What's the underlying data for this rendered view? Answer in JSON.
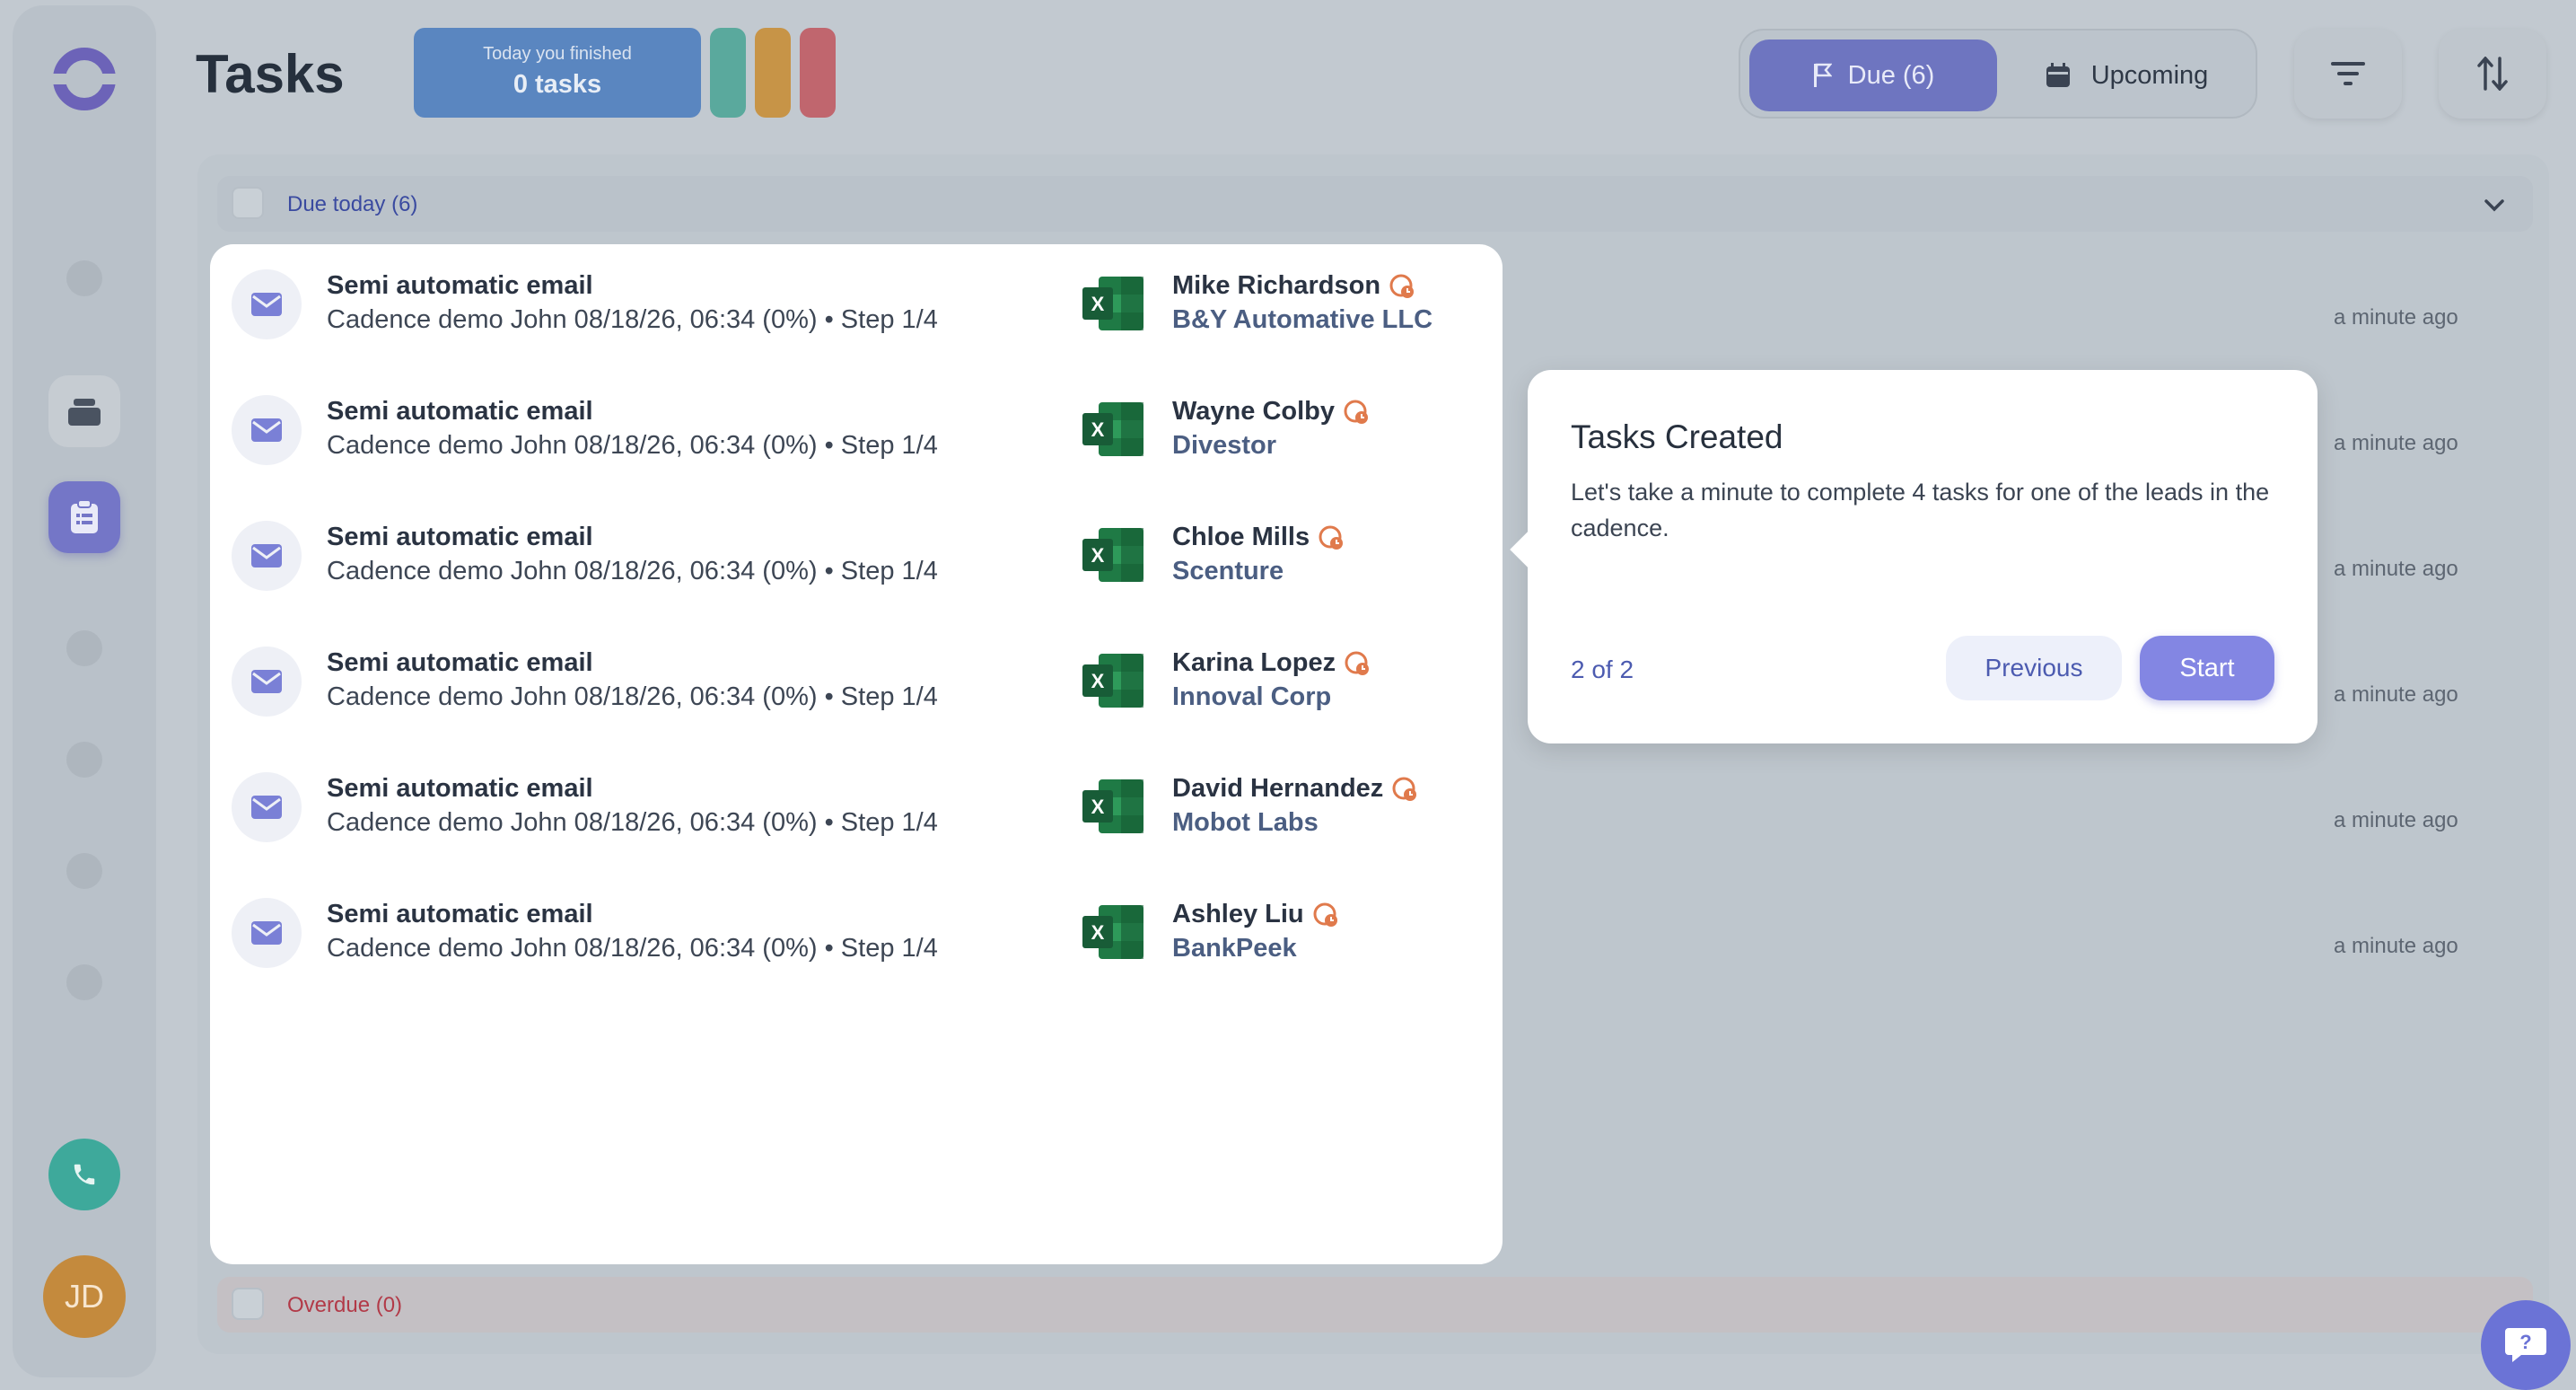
{
  "header": {
    "title": "Tasks",
    "finished_small": "Today you finished",
    "finished_count": "0 tasks",
    "tabs": {
      "due": "Due (6)",
      "upcoming": "Upcoming"
    }
  },
  "sections": {
    "due_today": "Due today (6)",
    "overdue": "Overdue (0)"
  },
  "tasks": [
    {
      "title": "Semi automatic email",
      "subtitle": "Cadence demo John 08/18/26, 06:34 (0%) • Step 1/4",
      "lead": "Mike Richardson",
      "company": "B&Y Automative LLC",
      "time": "a minute ago"
    },
    {
      "title": "Semi automatic email",
      "subtitle": "Cadence demo John 08/18/26, 06:34 (0%) • Step 1/4",
      "lead": "Wayne Colby",
      "company": "Divestor",
      "time": "a minute ago"
    },
    {
      "title": "Semi automatic email",
      "subtitle": "Cadence demo John 08/18/26, 06:34 (0%) • Step 1/4",
      "lead": "Chloe Mills",
      "company": "Scenture",
      "time": "a minute ago"
    },
    {
      "title": "Semi automatic email",
      "subtitle": "Cadence demo John 08/18/26, 06:34 (0%) • Step 1/4",
      "lead": "Karina Lopez",
      "company": "Innoval Corp",
      "time": "a minute ago"
    },
    {
      "title": "Semi automatic email",
      "subtitle": "Cadence demo John 08/18/26, 06:34 (0%) • Step 1/4",
      "lead": "David Hernandez",
      "company": "Mobot Labs",
      "time": "a minute ago"
    },
    {
      "title": "Semi automatic email",
      "subtitle": "Cadence demo John 08/18/26, 06:34 (0%) • Step 1/4",
      "lead": "Ashley Liu",
      "company": "BankPeek",
      "time": "a minute ago"
    }
  ],
  "popover": {
    "title": "Tasks Created",
    "body": "Let's take a minute to complete 4 tasks for one of the leads in the cadence.",
    "step": "2 of 2",
    "previous_label": "Previous",
    "start_label": "Start"
  },
  "sidebar": {
    "avatar_initials": "JD"
  },
  "colors": {
    "accent": "#8386e3",
    "due_tab": "#6e75c0",
    "overdue_text": "#b23a48",
    "phone": "#3ea99b",
    "avatar": "#c48a3d"
  },
  "icons": {
    "mail": "mail-icon",
    "excel": "excel-icon",
    "timezone": "globe-clock-icon"
  }
}
